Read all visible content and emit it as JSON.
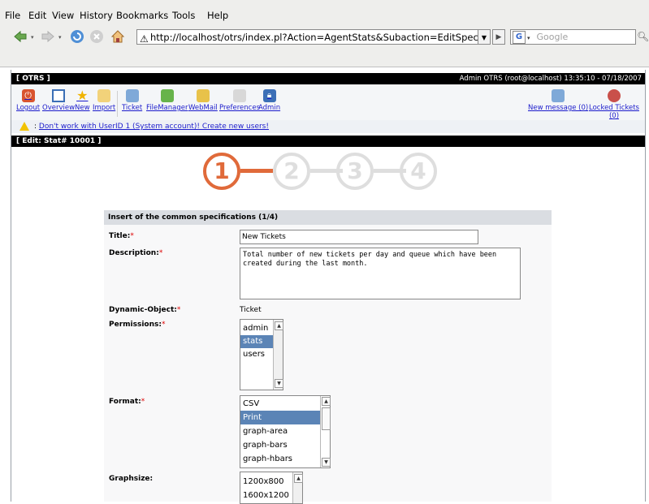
{
  "browser": {
    "menu": [
      "File",
      "Edit",
      "View",
      "History",
      "Bookmarks",
      "Tools",
      "Help"
    ],
    "url": "http://localhost/otrs/index.pl?Action=AgentStats&Subaction=EditSpecification&S",
    "search_placeholder": "Google"
  },
  "otrs": {
    "brand": "[ OTRS ]",
    "user_info": "Admin OTRS (root@localhost) 13:35:10 - 07/18/2007",
    "nav": [
      {
        "label": "Logout",
        "icon": "power-icon"
      },
      {
        "label": "Overview",
        "icon": "window-icon"
      },
      {
        "label": "New",
        "icon": "star-icon"
      },
      {
        "label": "Import",
        "icon": "import-icon"
      },
      {
        "label": "Ticket",
        "icon": "ticket-icon"
      },
      {
        "label": "FileManager",
        "icon": "filemanager-icon"
      },
      {
        "label": "WebMail",
        "icon": "webmail-icon"
      },
      {
        "label": "Preferences",
        "icon": "preferences-icon"
      },
      {
        "label": "Admin",
        "icon": "admin-icon"
      }
    ],
    "new_message": "New message (0)",
    "locked_tickets": "Locked Tickets (0)",
    "warning_prefix": ": ",
    "warning": "Don't work with UserID 1 (System account)! Create new users!",
    "edit_title": "[ Edit: Stat# 10001 ]"
  },
  "steps": [
    "1",
    "2",
    "3",
    "4"
  ],
  "active_step": 1,
  "form": {
    "title": "Insert of the common specifications (1/4)",
    "fields": {
      "title_label": "Title:",
      "title_value": "New Tickets",
      "description_label": "Description:",
      "description_value": "Total number of new tickets per day and queue which have been created during the last month.",
      "dynamic_object_label": "Dynamic-Object:",
      "dynamic_object_value": "Ticket",
      "permissions_label": "Permissions:",
      "permissions_options": [
        "admin",
        "stats",
        "users"
      ],
      "permissions_selected": "stats",
      "format_label": "Format:",
      "format_options": [
        "CSV",
        "Print",
        "graph-area",
        "graph-bars",
        "graph-hbars"
      ],
      "format_selected": "Print",
      "graphsize_label": "Graphsize:",
      "graphsize_options": [
        "1200x800",
        "1600x1200"
      ]
    },
    "required_mark": "*"
  },
  "colors": {
    "active_step": "#e06a3a",
    "inactive_step": "#dedede",
    "selected_option": "#5b84b6",
    "link": "#1c1ccc",
    "header_bg": "#000000"
  }
}
